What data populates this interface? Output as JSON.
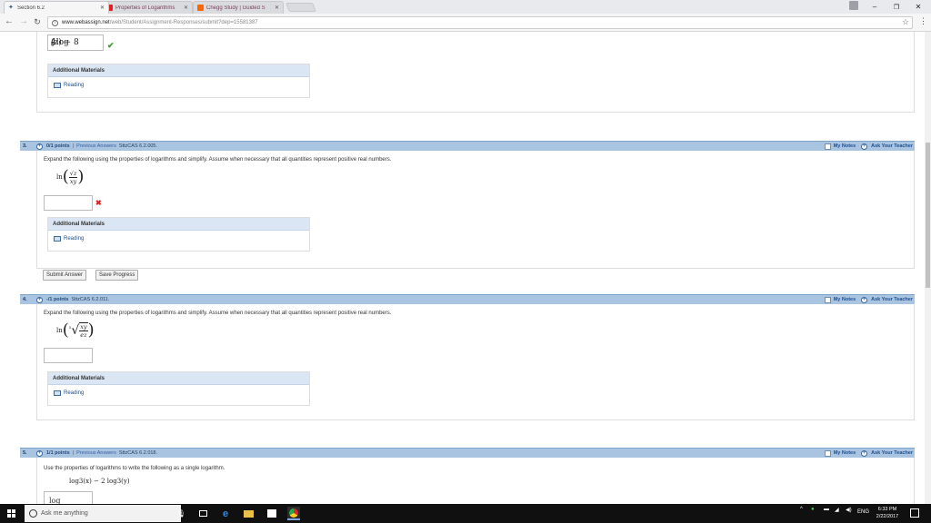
{
  "browser": {
    "tabs": [
      {
        "label": "Section 6.2",
        "active": true
      },
      {
        "label": "Properties of Logarithms",
        "active": false
      },
      {
        "label": "Chegg Study | Guided S",
        "active": false
      }
    ],
    "url_host": "www.webassign.net",
    "url_path": "/web/Student/Assignment-Responses/submit?dep=15581387"
  },
  "q2": {
    "answer_expr": "4log",
    "answer_base": "6",
    "answer_rest": "(z) − 8",
    "addl_title": "Additional Materials",
    "reading": "Reading"
  },
  "q3": {
    "num": "3.",
    "points": "0/1 points",
    "prev": "Previous Answers",
    "code": "SttzCAS 6.2.005.",
    "my_notes": "My Notes",
    "ask": "Ask Your Teacher",
    "text": "Expand the following using the properties of logarithms and simplify. Assume when necessary that all quantities represent positive real numbers.",
    "expr_ln": "ln",
    "expr_num": "√z",
    "expr_den": "xy",
    "addl_title": "Additional Materials",
    "reading": "Reading",
    "submit": "Submit Answer",
    "save": "Save Progress"
  },
  "q4": {
    "num": "4.",
    "points": "-/1 points",
    "code": "SttzCAS 6.2.011.",
    "my_notes": "My Notes",
    "ask": "Ask Your Teacher",
    "text": "Expand the following using the properties of logarithms and simplify. Assume when necessary that all quantities represent positive real numbers.",
    "expr_ln": "ln",
    "expr_root": "5",
    "expr_num": "xy",
    "expr_den": "ez",
    "addl_title": "Additional Materials",
    "reading": "Reading"
  },
  "q5": {
    "num": "5.",
    "points": "1/1 points",
    "prev": "Previous Answers",
    "code": "SttzCAS 6.2.018.",
    "my_notes": "My Notes",
    "ask": "Ask Your Teacher",
    "text": "Use the properties of logarithms to write the following as a single logarithm.",
    "expr": "log3(x) − 2 log3(y)",
    "partial": "log"
  },
  "taskbar": {
    "search_placeholder": "Ask me anything",
    "lang": "ENG",
    "time": "6:33 PM",
    "date": "2/22/2017"
  }
}
